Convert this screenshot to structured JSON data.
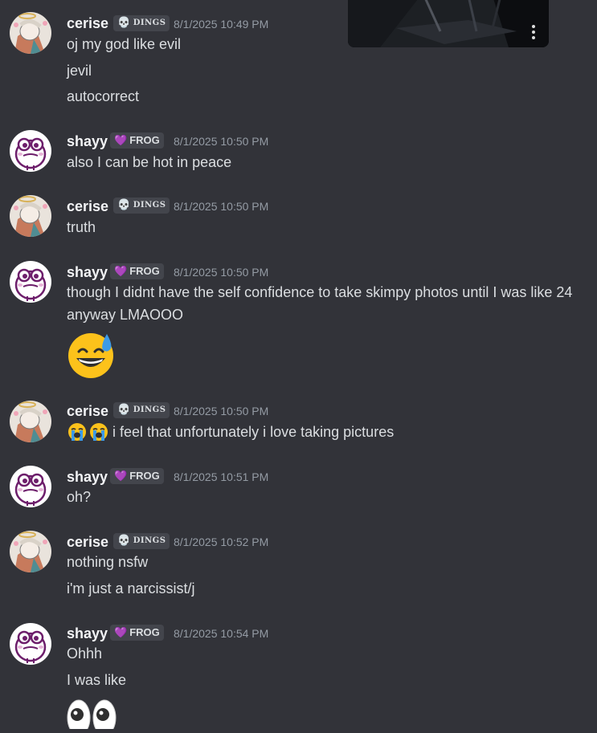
{
  "users": {
    "cerise": {
      "name": "cerise",
      "tag": "DINGS",
      "tag_icon": "skull-icon"
    },
    "shayy": {
      "name": "shayy",
      "tag": "FROG",
      "tag_icon": "purple-heart-icon"
    }
  },
  "messages": [
    {
      "author": "cerise",
      "timestamp": "8/1/2025 10:49 PM",
      "lines": [
        "oj my god like evil",
        "jevil",
        "autocorrect"
      ]
    },
    {
      "author": "shayy",
      "timestamp": "8/1/2025 10:50 PM",
      "lines": [
        "also I can be hot in peace"
      ]
    },
    {
      "author": "cerise",
      "timestamp": "8/1/2025 10:50 PM",
      "lines": [
        "truth"
      ]
    },
    {
      "author": "shayy",
      "timestamp": "8/1/2025 10:50 PM",
      "lines": [
        "though I didnt have the self confidence to take skimpy photos until I was like 24 anyway LMAOOO"
      ],
      "emoji": "sweat-smile-emoji"
    },
    {
      "author": "cerise",
      "timestamp": "8/1/2025 10:50 PM",
      "lines": [
        "i feel that unfortunately i love taking pictures"
      ],
      "inline_emoji": "loudly-crying-emoji"
    },
    {
      "author": "shayy",
      "timestamp": "8/1/2025 10:51 PM",
      "lines": [
        "oh?"
      ]
    },
    {
      "author": "cerise",
      "timestamp": "8/1/2025 10:52 PM",
      "lines": [
        "nothing nsfw",
        "i'm just a narcissist/j"
      ]
    },
    {
      "author": "shayy",
      "timestamp": "8/1/2025 10:54 PM",
      "lines": [
        "Ohhh",
        "I was like"
      ],
      "emoji": "eyes-emoji"
    }
  ],
  "colors": {
    "background": "#323339",
    "text": "#dbdee1",
    "username": "#f2f3f5",
    "timestamp": "#949ba4",
    "tag_bg": "#43454c",
    "frog_heart": "#b58ff0"
  }
}
